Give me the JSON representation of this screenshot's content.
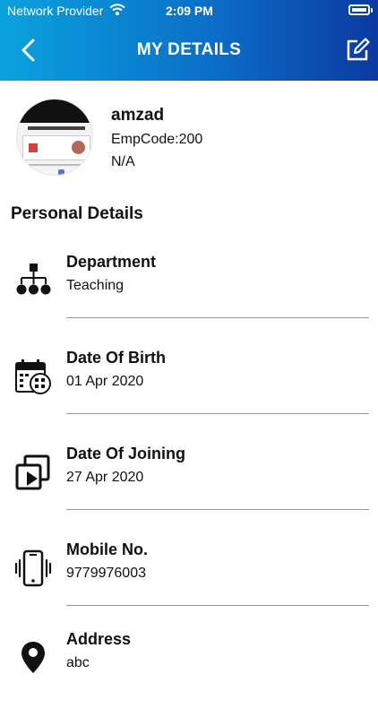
{
  "status_bar": {
    "carrier": "Network Provider",
    "time": "2:09 PM"
  },
  "nav": {
    "title": "MY DETAILS",
    "back_icon": "chevron-left-icon",
    "edit_icon": "edit-icon"
  },
  "profile": {
    "name": "amzad",
    "emp_code": "EmpCode:200",
    "extra": "N/A"
  },
  "section_title": "Personal Details",
  "details": [
    {
      "label": "Department",
      "value": "Teaching",
      "icon": "org-chart-icon"
    },
    {
      "label": "Date Of Birth",
      "value": "01 Apr 2020",
      "icon": "calendar-icon"
    },
    {
      "label": "Date Of Joining",
      "value": "27 Apr 2020",
      "icon": "join-icon"
    },
    {
      "label": "Mobile No.",
      "value": "9779976003",
      "icon": "mobile-phone-icon"
    },
    {
      "label": "Address",
      "value": "abc",
      "icon": "location-pin-icon"
    }
  ],
  "colors": {
    "header_start": "#0aa2de",
    "header_end": "#0b3aa0"
  }
}
